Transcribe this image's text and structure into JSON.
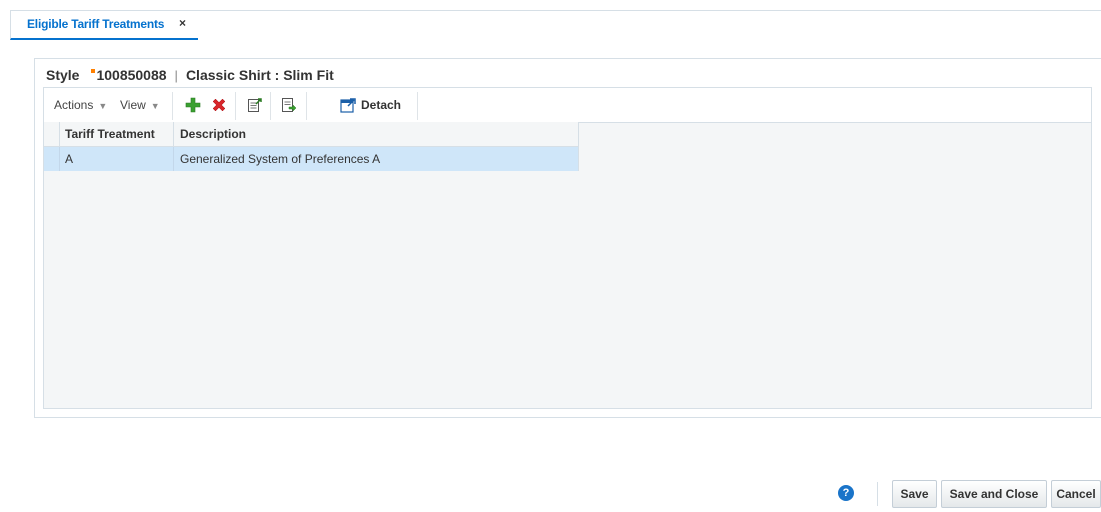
{
  "tab": {
    "label": "Eligible Tariff Treatments",
    "close": "×"
  },
  "header": {
    "style_label": "Style",
    "style_id": "100850088",
    "separator": "|",
    "style_name": "Classic Shirt : Slim Fit"
  },
  "toolbar": {
    "actions_label": "Actions",
    "view_label": "View",
    "detach_label": "Detach",
    "icons": [
      "add-icon",
      "delete-icon",
      "export-icon",
      "upload-icon",
      "detach-icon"
    ]
  },
  "table": {
    "columns": [
      "Tariff Treatment",
      "Description"
    ],
    "rows": [
      {
        "tariff_treatment": "A",
        "description": "Generalized System of Preferences A"
      }
    ]
  },
  "footer": {
    "help": "?",
    "save": "Save",
    "save_and_close": "Save and Close",
    "cancel": "Cancel"
  },
  "colors": {
    "accent": "#0572ce",
    "selected_row": "#cfe6f9",
    "add_icon": "#3aa030",
    "delete_icon": "#d8262b",
    "required_marker": "#ff8000"
  }
}
